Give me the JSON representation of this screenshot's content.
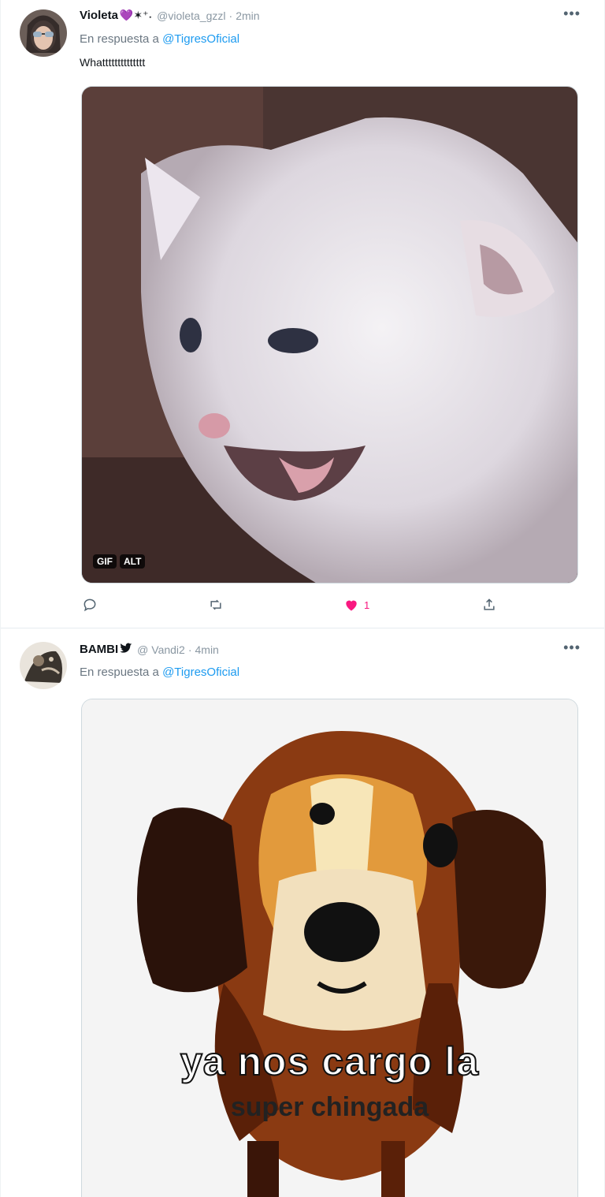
{
  "tweets": [
    {
      "display_name": "Violeta",
      "badge": "💜✶⁺˖",
      "handle": "@violeta_gzzl",
      "separator": "·",
      "time": "2min",
      "reply_prefix": "En respuesta a",
      "reply_mention": "@TigresOficial",
      "text": "Whatttttttttttttt",
      "media": {
        "type": "gif",
        "badges": [
          "GIF",
          "ALT"
        ]
      },
      "actions": {
        "reply": "",
        "retweet": "",
        "like": "1",
        "share": ""
      },
      "more_icon": "more-icon"
    },
    {
      "display_name": "BAMBI",
      "badge": "🐦",
      "handle": "@ Vandi2",
      "separator": "·",
      "time": "4min",
      "reply_prefix": "En respuesta a",
      "reply_mention": "@TigresOficial",
      "media": {
        "type": "image",
        "caption_line1": "ya nos cargo la",
        "caption_line2": "super chingada"
      },
      "more_icon": "more-icon"
    }
  ],
  "colors": {
    "link": "#1d9bf0",
    "like": "#f91880",
    "muted": "#536471"
  }
}
